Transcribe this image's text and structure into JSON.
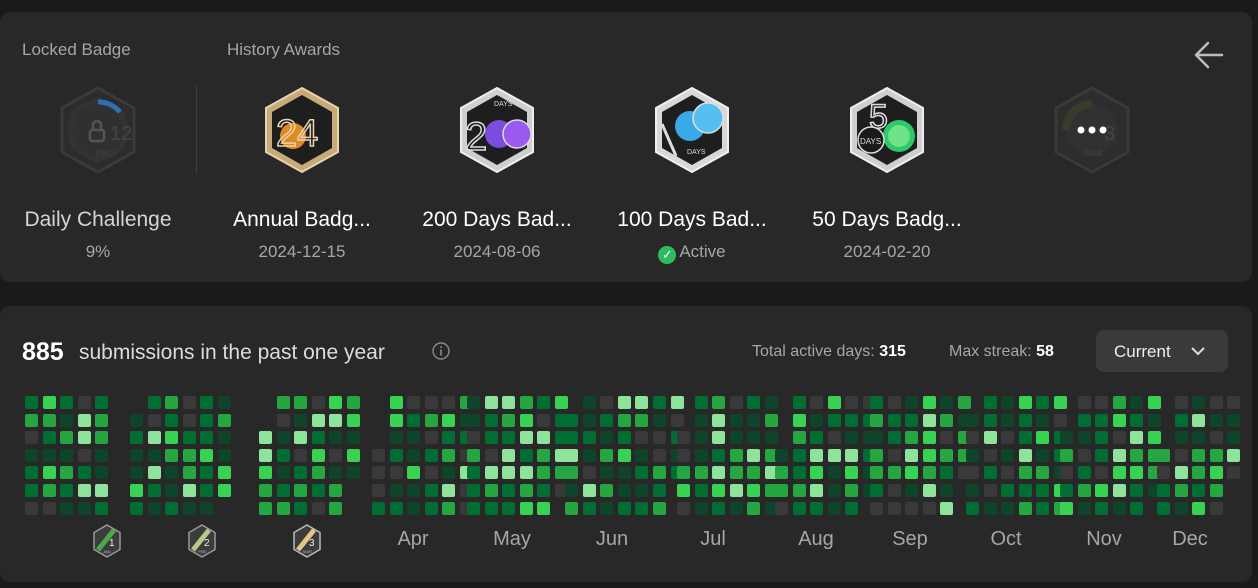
{
  "badges_section": {
    "locked_label": "Locked Badge",
    "history_label": "History Awards",
    "locked_badge": {
      "title": "Daily Challenge",
      "progress": "9%",
      "icon": "lock-icon",
      "month": "12",
      "month_abbr": "DEC"
    },
    "history": [
      {
        "title": "Annual Badg...",
        "date": "2024-12-15",
        "glyph": "24"
      },
      {
        "title": "200 Days Bad...",
        "date": "2024-08-06",
        "glyph": "2",
        "days_text": "DAYS"
      },
      {
        "title": "100 Days Bad...",
        "status": "Active",
        "days_text": "DAYS"
      },
      {
        "title": "50 Days Badg...",
        "date": "2024-02-20",
        "glyph": "5",
        "days_text": "DAYS"
      }
    ],
    "next_badge": {
      "month": "3",
      "month_abbr": "MAR"
    }
  },
  "heatmap": {
    "count": "885",
    "text": "submissions in the past one year",
    "total_active_label": "Total active days:",
    "total_active": "315",
    "max_streak_label": "Max streak:",
    "max_streak": "58",
    "dropdown": "Current",
    "month_badges": [
      {
        "num": "1",
        "abbr": "JAN"
      },
      {
        "num": "2",
        "abbr": "FEB"
      },
      {
        "num": "3",
        "abbr": "MAR"
      }
    ],
    "months": [
      "Apr",
      "May",
      "Jun",
      "Jul",
      "Aug",
      "Sep",
      "Oct",
      "Nov",
      "Dec"
    ],
    "colors": {
      "empty": "#393939",
      "l1": "#0e4429",
      "l2": "#006d32",
      "l3": "#26a641",
      "l4": "#39d353",
      "l5": "#8ee39b"
    }
  }
}
